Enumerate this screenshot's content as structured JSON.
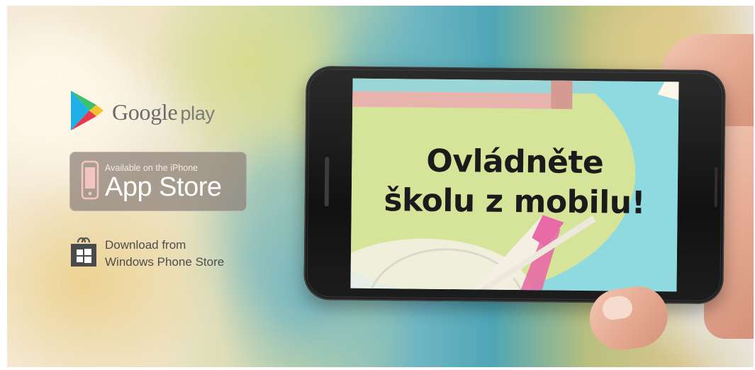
{
  "promo": {
    "headline_line1": "Ovládněte",
    "headline_line2": "školu z mobilu!"
  },
  "stores": {
    "google": {
      "name": "Google",
      "suffix": "play",
      "icon": "google-play-icon"
    },
    "apple": {
      "small": "Available on the iPhone",
      "big": "App Store",
      "icon": "iphone-icon"
    },
    "windows": {
      "line1": "Download from",
      "line2": "Windows Phone Store",
      "icon": "windows-store-icon"
    }
  },
  "colors": {
    "screen_cyan": "#8fd9e0",
    "screen_green": "#d6e49a",
    "screen_pink": "#e8b3ad",
    "accent_pink": "#e86aa6"
  }
}
